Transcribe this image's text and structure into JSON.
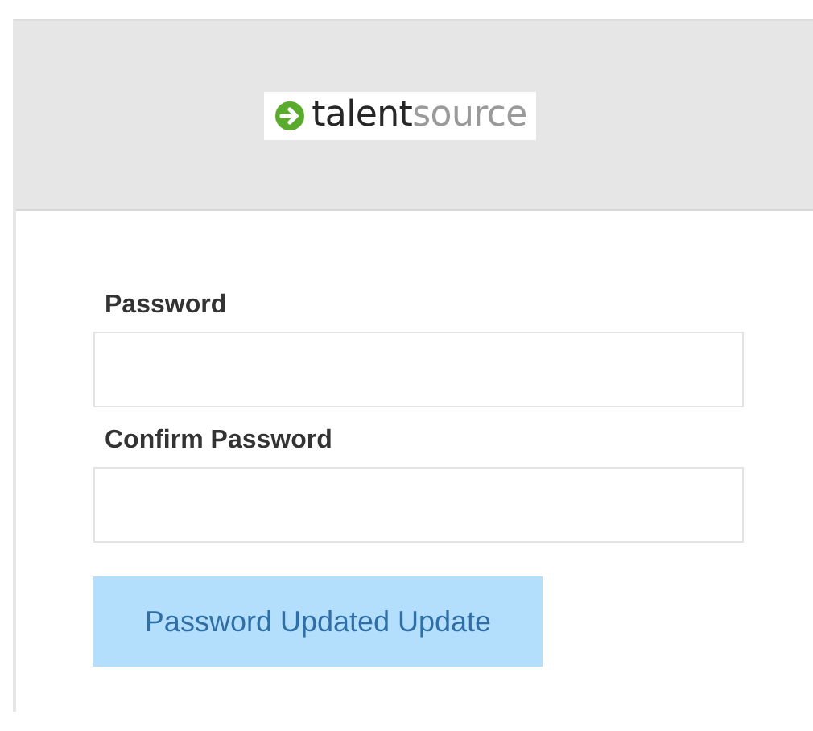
{
  "header": {
    "logo": {
      "primary": "talent",
      "secondary": "source"
    }
  },
  "fields": [
    {
      "label": "Password"
    },
    {
      "label": "Confirm Password"
    }
  ],
  "submit_button": {
    "label": "Password Updated Update",
    "disabled": true
  }
}
